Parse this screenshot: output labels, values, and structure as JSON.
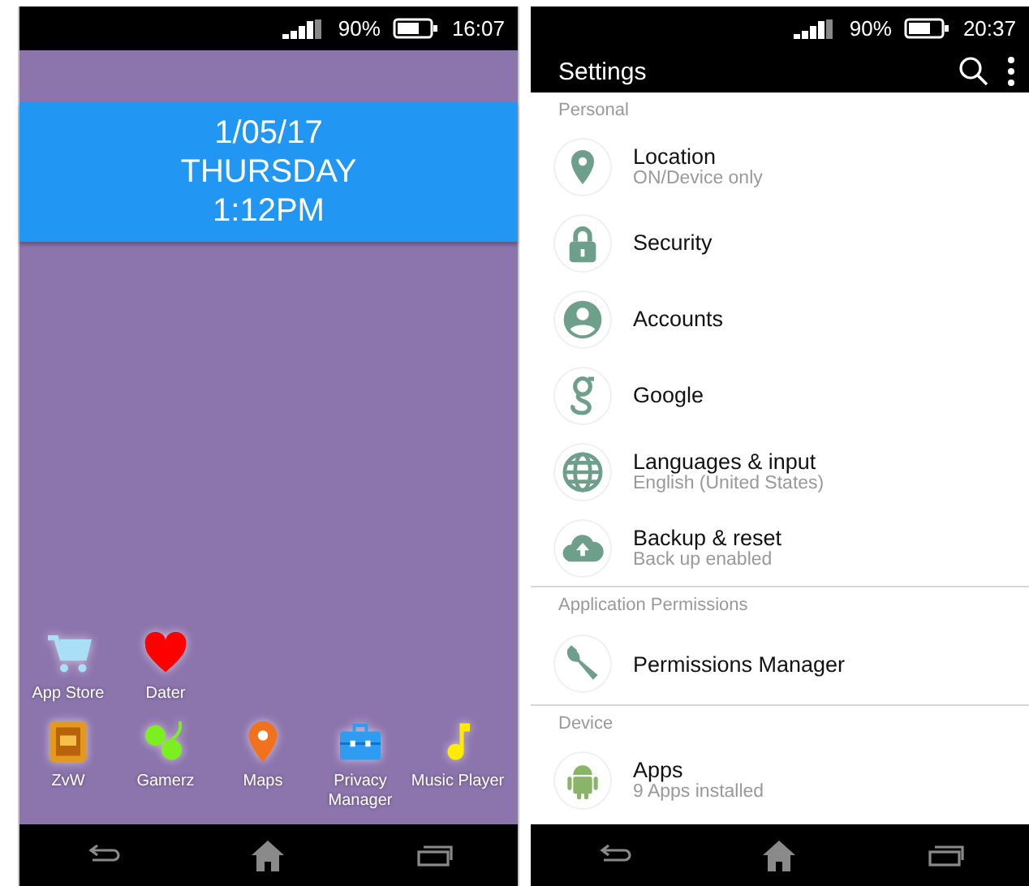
{
  "home_screen": {
    "status_bar": {
      "battery": "90%",
      "time": "16:07"
    },
    "clock": {
      "date": "1/05/17",
      "day": "THURSDAY",
      "time": "1:12PM"
    },
    "app_rows": [
      {
        "apps": [
          {
            "label": "App Store"
          },
          {
            "label": "Dater"
          }
        ]
      },
      {
        "apps": [
          {
            "label": "ZvW"
          },
          {
            "label": "Gamerz"
          },
          {
            "label": "Maps"
          },
          {
            "label": "Privacy Manager"
          },
          {
            "label": "Music Player"
          }
        ]
      }
    ]
  },
  "settings_screen": {
    "status_bar": {
      "battery": "90%",
      "time": "20:37"
    },
    "title": "Settings",
    "sections": [
      {
        "header": "Personal",
        "items": [
          {
            "title": "Location",
            "subtitle": "ON/Device only"
          },
          {
            "title": "Security"
          },
          {
            "title": "Accounts"
          },
          {
            "title": "Google"
          },
          {
            "title": "Languages & input",
            "subtitle": "English (United States)"
          },
          {
            "title": "Backup & reset",
            "subtitle": "Back up enabled"
          }
        ]
      },
      {
        "header": "Application Permissions",
        "items": [
          {
            "title": "Permissions Manager"
          }
        ]
      },
      {
        "header": "Device",
        "items": [
          {
            "title": "Apps",
            "subtitle": "9 Apps installed"
          }
        ]
      }
    ]
  }
}
